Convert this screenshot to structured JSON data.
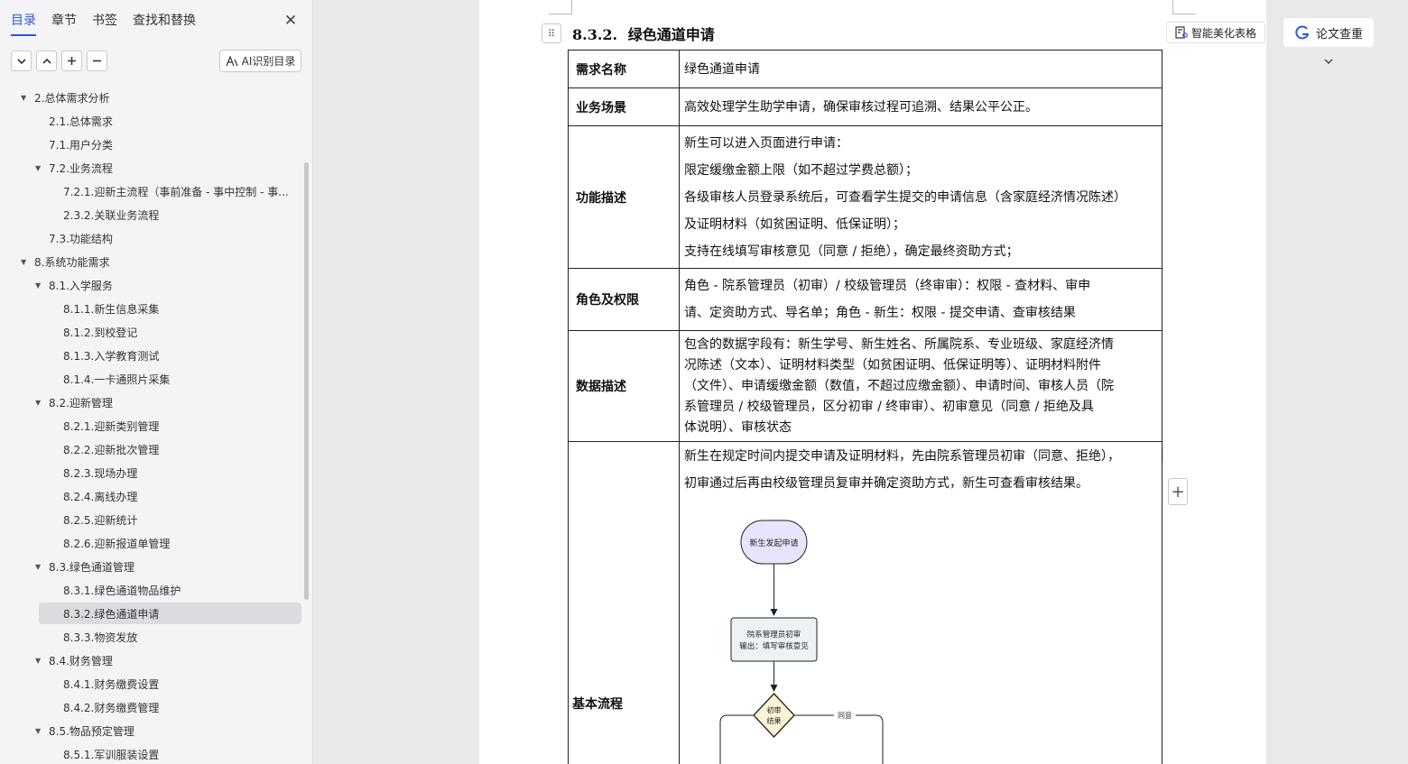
{
  "sidebar": {
    "tabs": [
      "目录",
      "章节",
      "书签",
      "查找和替换"
    ],
    "active_tab": 0,
    "toolbar_icons": [
      "chevron-down-icon",
      "chevron-up-icon",
      "plus-icon",
      "minus-icon"
    ],
    "ai_button_label": "AI识别目录",
    "toc": [
      {
        "label": "2.总体需求分析",
        "level": 0,
        "expanded": true
      },
      {
        "label": "2.1.总体需求",
        "level": 1
      },
      {
        "label": "7.1.用户分类",
        "level": 1
      },
      {
        "label": "7.2.业务流程",
        "level": 1,
        "expanded": true
      },
      {
        "label": "7.2.1.迎新主流程（事前准备 - 事中控制 - 事...",
        "level": 2
      },
      {
        "label": "2.3.2.关联业务流程",
        "level": 2
      },
      {
        "label": "7.3.功能结构",
        "level": 1
      },
      {
        "label": "8.系统功能需求",
        "level": 0,
        "expanded": true
      },
      {
        "label": "8.1.入学服务",
        "level": 1,
        "expanded": true
      },
      {
        "label": "8.1.1.新生信息采集",
        "level": 2
      },
      {
        "label": "8.1.2.到校登记",
        "level": 2
      },
      {
        "label": "8.1.3.入学教育测试",
        "level": 2
      },
      {
        "label": "8.1.4.一卡通照片采集",
        "level": 2
      },
      {
        "label": "8.2.迎新管理",
        "level": 1,
        "expanded": true
      },
      {
        "label": "8.2.1.迎新类别管理",
        "level": 2
      },
      {
        "label": "8.2.2.迎新批次管理",
        "level": 2
      },
      {
        "label": "8.2.3.现场办理",
        "level": 2
      },
      {
        "label": "8.2.4.离线办理",
        "level": 2
      },
      {
        "label": "8.2.5.迎新统计",
        "level": 2
      },
      {
        "label": "8.2.6.迎新报道单管理",
        "level": 2
      },
      {
        "label": "8.3.绿色通道管理",
        "level": 1,
        "expanded": true
      },
      {
        "label": "8.3.1.绿色通道物品维护",
        "level": 2
      },
      {
        "label": "8.3.2.绿色通道申请",
        "level": 2,
        "selected": true
      },
      {
        "label": "8.3.3.物资发放",
        "level": 2
      },
      {
        "label": "8.4.财务管理",
        "level": 1,
        "expanded": true
      },
      {
        "label": "8.4.1.财务缴费设置",
        "level": 2
      },
      {
        "label": "8.4.2.财务缴费管理",
        "level": 2
      },
      {
        "label": "8.5.物品预定管理",
        "level": 1,
        "expanded": true
      },
      {
        "label": "8.5.1.军训服装设置",
        "level": 2
      }
    ]
  },
  "document": {
    "heading_number": "8.3.2.",
    "heading_title": "绿色通道申请",
    "beautify_button": "智能美化表格",
    "table": {
      "rows": [
        {
          "key": "需求名称",
          "lines": [
            "绿色通道申请"
          ]
        },
        {
          "key": "业务场景",
          "lines": [
            "高效处理学生助学申请，确保审核过程可追溯、结果公平公正。"
          ]
        },
        {
          "key": "功能描述",
          "lines": [
            "新生可以进入页面进行申请：",
            "限定缓缴金额上限（如不超过学费总额）；",
            "各级审核人员登录系统后，可查看学生提交的申请信息（含家庭经济情况陈述）",
            "及证明材料（如贫困证明、低保证明）；",
            "支持在线填写审核意见（同意 / 拒绝），确定最终资助方式；"
          ]
        },
        {
          "key": "角色及权限",
          "lines": [
            "角色 - 院系管理员（初审）/ 校级管理员（终审审）：权限 - 查材料、审申",
            "请、定资助方式、导名单；角色 - 新生：权限 - 提交申请、查审核结果"
          ]
        },
        {
          "key": "数据描述",
          "lines": [
            "包含的数据字段有：新生学号、新生姓名、所属院系、专业班级、家庭经济情",
            "况陈述（文本）、证明材料类型（如贫困证明、低保证明等）、证明材料附件",
            "（文件）、申请缓缴金额（数值，不超过应缴金额）、申请时间、审核人员（院",
            "系管理员 / 校级管理员，区分初审 / 终审审）、初审意见（同意 / 拒绝及具",
            "体说明）、审核状态"
          ]
        },
        {
          "key": "基本流程",
          "lines": [
            "新生在规定时间内提交申请及证明材料，先由院系管理员初审（同意、拒绝），",
            "初审通过后再由校级管理员复审并确定资助方式，新生可查看审核结果。"
          ]
        }
      ]
    },
    "flowchart": {
      "start_node": "新生发起申请",
      "review_node_line1": "院系管理员初审",
      "review_node_line2": "输出：填写审核意见",
      "decision_line1": "初审",
      "decision_line2": "结果",
      "agree_label": "同意"
    }
  },
  "right_panel": {
    "check_button": "论文查重"
  },
  "colors": {
    "accent": "#2a5bd7",
    "start_node_fill": "#e8e4fb",
    "process_node_fill": "#eef2f7",
    "decision_fill": "#fbf3d4"
  }
}
